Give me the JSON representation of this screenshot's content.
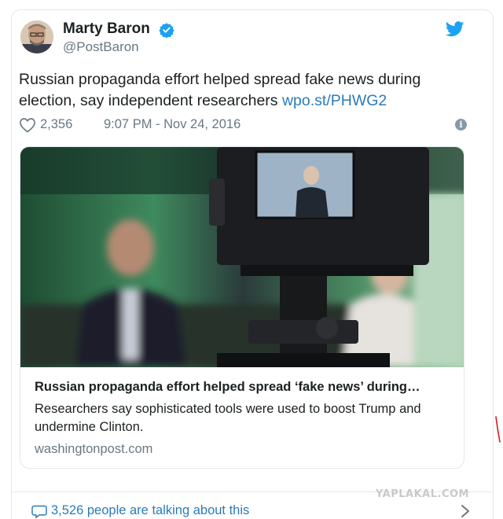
{
  "author": {
    "name": "Marty Baron",
    "handle": "@PostBaron",
    "verified": true
  },
  "tweet": {
    "text": "Russian propaganda effort helped spread fake news during election, say independent researchers ",
    "link_text": "wpo.st/PHWG2",
    "like_count": "2,356",
    "timestamp": "9:07 PM - Nov 24, 2016"
  },
  "link_card": {
    "title": "Russian propaganda effort helped spread ‘fake news’ during…",
    "description": "Researchers say sophisticated tools were used to boost Trump and undermine Clinton.",
    "domain": "washingtonpost.com"
  },
  "footer": {
    "talking_text": "3,526 people are talking about this"
  },
  "watermark": "YAPLAKAL.COM",
  "icons": {
    "verified": "verified-badge-icon",
    "brand": "twitter-bird-icon",
    "like": "heart-icon",
    "info": "info-icon",
    "comment": "comment-bubble-icon",
    "chevron": "chevron-right-icon"
  },
  "colors": {
    "link": "#2b7bb9",
    "verified": "#1da1f2",
    "muted": "#697882",
    "text": "#1c2022",
    "border": "#e1e8ed"
  }
}
